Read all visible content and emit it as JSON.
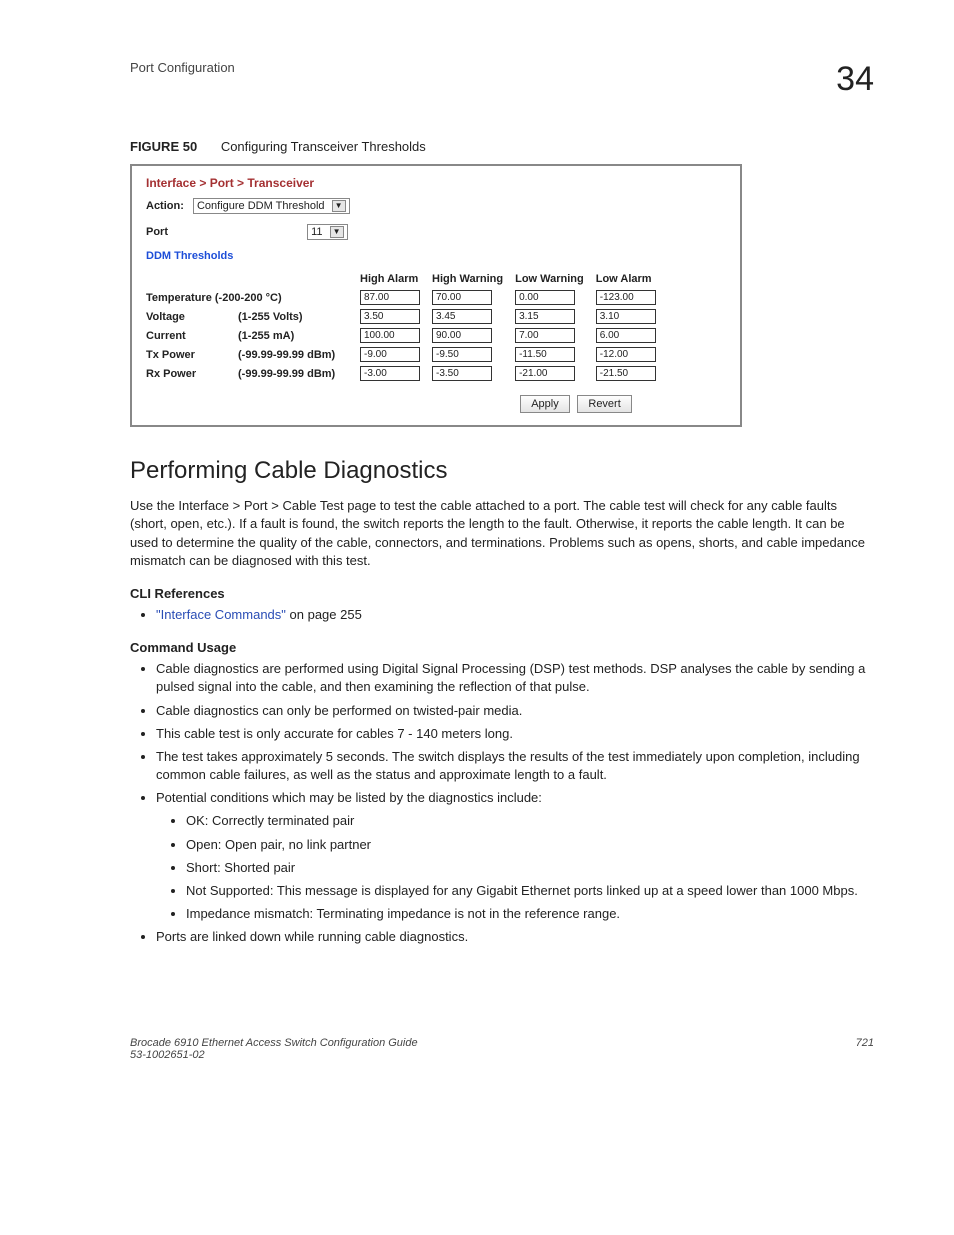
{
  "header": {
    "left": "Port Configuration",
    "right": "34"
  },
  "figure": {
    "label": "FIGURE 50",
    "caption": "Configuring Transceiver Thresholds"
  },
  "panel": {
    "breadcrumb": "Interface > Port > Transceiver",
    "action_label": "Action:",
    "action_value": "Configure DDM Threshold",
    "port_label": "Port",
    "port_value": "11",
    "ddm_title": "DDM Thresholds",
    "col1": "High Alarm",
    "col2": "High Warning",
    "col3": "Low Warning",
    "col4": "Low Alarm",
    "rows": [
      {
        "name": "Temperature (-200-200 °C)",
        "range": "",
        "ha": "87.00",
        "hw": "70.00",
        "lw": "0.00",
        "la": "-123.00"
      },
      {
        "name": "Voltage",
        "range": "(1-255 Volts)",
        "ha": "3.50",
        "hw": "3.45",
        "lw": "3.15",
        "la": "3.10"
      },
      {
        "name": "Current",
        "range": "(1-255 mA)",
        "ha": "100.00",
        "hw": "90.00",
        "lw": "7.00",
        "la": "6.00"
      },
      {
        "name": "Tx Power",
        "range": "(-99.99-99.99 dBm)",
        "ha": "-9.00",
        "hw": "-9.50",
        "lw": "-11.50",
        "la": "-12.00"
      },
      {
        "name": "Rx Power",
        "range": "(-99.99-99.99 dBm)",
        "ha": "-3.00",
        "hw": "-3.50",
        "lw": "-21.00",
        "la": "-21.50"
      }
    ],
    "apply": "Apply",
    "revert": "Revert"
  },
  "section_title": "Performing Cable Diagnostics",
  "intro": "Use the Interface > Port > Cable Test page to test the cable attached to a port. The cable test will check for any cable faults (short, open, etc.). If a fault is found, the switch reports the length to the fault. Otherwise, it reports the cable length. It can be used to determine the quality of the cable, connectors, and terminations. Problems such as opens, shorts, and cable impedance mismatch can be diagnosed with this test.",
  "cli_hd": "CLI References",
  "cli_link": "\"Interface Commands\"",
  "cli_suffix": " on page 255",
  "usage_hd": "Command Usage",
  "usage": [
    "Cable diagnostics are performed using Digital Signal Processing (DSP) test methods. DSP analyses the cable by sending a pulsed signal into the cable, and then examining the reflection of that pulse.",
    "Cable diagnostics can only be performed on twisted-pair media.",
    "This cable test is only accurate for cables 7 - 140 meters long.",
    "The test takes approximately 5 seconds. The switch displays the results of the test immediately upon completion, including common cable failures, as well as the status and approximate length to a fault.",
    "Potential conditions which may be listed by the diagnostics include:",
    "Ports are linked down while running cable diagnostics."
  ],
  "conditions": [
    "OK: Correctly terminated pair",
    "Open: Open pair, no link partner",
    "Short: Shorted pair",
    "Not Supported: This message is displayed for any Gigabit Ethernet ports linked up at a speed lower than 1000 Mbps.",
    "Impedance mismatch: Terminating impedance is not in the reference range."
  ],
  "footer": {
    "line1": "Brocade 6910 Ethernet Access Switch Configuration Guide",
    "line2": "53-1002651-02",
    "page": "721"
  }
}
